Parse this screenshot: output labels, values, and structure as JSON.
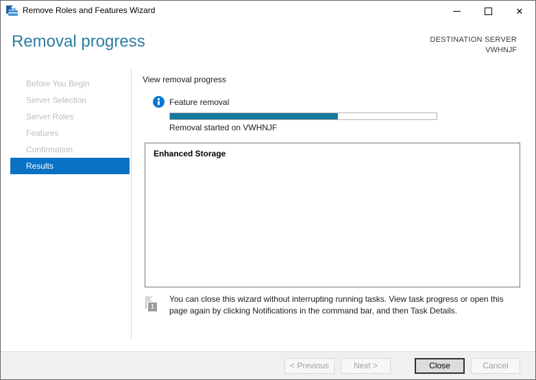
{
  "window": {
    "title": "Remove Roles and Features Wizard"
  },
  "header": {
    "title": "Removal progress",
    "destination_label": "DESTINATION SERVER",
    "server_name": "VWHNJF"
  },
  "sidebar": {
    "items": [
      {
        "label": "Before You Begin",
        "state": "disabled"
      },
      {
        "label": "Server Selection",
        "state": "disabled"
      },
      {
        "label": "Server Roles",
        "state": "disabled"
      },
      {
        "label": "Features",
        "state": "disabled"
      },
      {
        "label": "Confirmation",
        "state": "disabled"
      },
      {
        "label": "Results",
        "state": "selected"
      }
    ]
  },
  "main": {
    "section_title": "View removal progress",
    "task": {
      "icon": "info-icon",
      "title": "Feature removal",
      "progress_percent": 63,
      "status": "Removal started on VWHNJF"
    },
    "results_box": {
      "items": [
        "Enhanced Storage"
      ]
    },
    "note": {
      "icon": "notification-flag-icon",
      "badge": "1",
      "text": "You can close this wizard without interrupting running tasks. View task progress or open this page again by clicking Notifications in the command bar, and then Task Details."
    }
  },
  "footer": {
    "buttons": [
      {
        "label": "< Previous",
        "state": "disabled"
      },
      {
        "label": "Next >",
        "state": "disabled"
      },
      {
        "label": "Close",
        "state": "default"
      },
      {
        "label": "Cancel",
        "state": "disabled"
      }
    ]
  },
  "colors": {
    "accent_blue": "#0a72c4",
    "heading_teal": "#2e7d9f",
    "progress_teal": "#15799e",
    "info_icon_blue": "#0b76d4"
  }
}
